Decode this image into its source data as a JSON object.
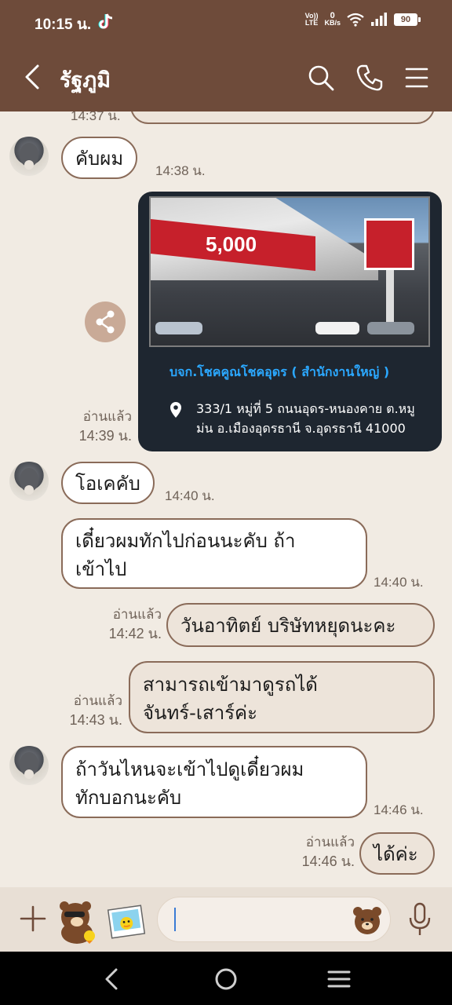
{
  "status_bar": {
    "time": "10:15 น.",
    "lte_label": "VoLTE",
    "data_rate": "0",
    "data_unit": "KB/s",
    "battery": "90"
  },
  "header": {
    "title": "รัฐภูมิ",
    "back_icon": "back-arrow-icon",
    "search_icon": "search-icon",
    "call_icon": "phone-icon",
    "menu_icon": "menu-icon"
  },
  "messages": [
    {
      "time": "14:37 น."
    },
    {
      "text": "คับผม",
      "time": "14:38 น."
    },
    {
      "read": "อ่านแล้ว",
      "time": "14:39 น.",
      "card": {
        "banner": "5,000",
        "title": "บจก.โชคคูณโชคอุดร ( สำนักงานใหญ่ )",
        "address": "333/1 หมู่ที่ 5 ถนนอุดร-หนองคาย ต.หมู ม่น อ.เมืองอุดรธานี จ.อุดรธานี 41000"
      }
    },
    {
      "text": "โอเคคับ",
      "time": "14:40 น."
    },
    {
      "text": "เดี๋ยวผมทักไปก่อนนะคับ ถ้าเข้าไป",
      "line1": "เดี๋ยวผมทักไปก่อนนะคับ ถ้า",
      "line2": "เข้าไป",
      "time": "14:40 น."
    },
    {
      "text": "วันอาทิตย์ บริษัทหยุดนะคะ",
      "read": "อ่านแล้ว",
      "time": "14:42 น."
    },
    {
      "line1": "สามารถเข้ามาดูรถได้",
      "line2": "จันทร์-เสาร์ค่ะ",
      "read": "อ่านแล้ว",
      "time": "14:43 น."
    },
    {
      "line1": "ถ้าวันไหนจะเข้าไปดูเดี๋ยวผม",
      "line2": "ทักบอกนะคับ",
      "time": "14:46 น."
    },
    {
      "text": "ได้ค่ะ",
      "read": "อ่านแล้ว",
      "time": "14:46 น."
    }
  ],
  "input": {
    "value": ""
  }
}
